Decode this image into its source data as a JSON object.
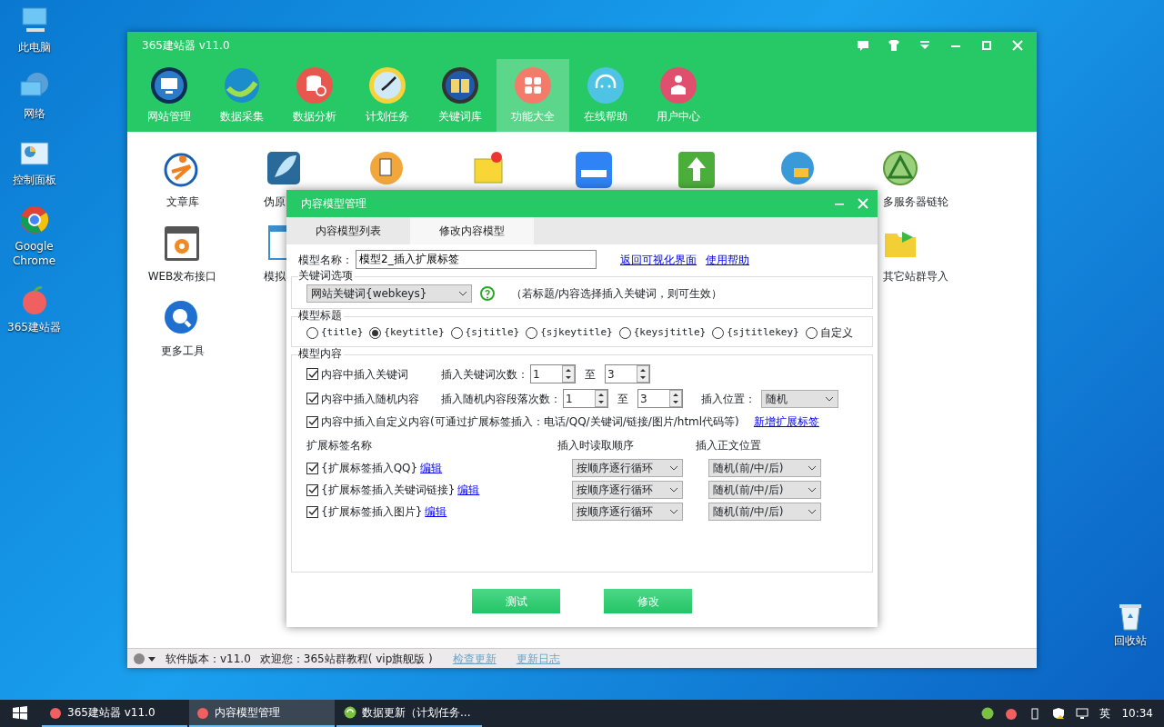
{
  "desktop_icons": [
    {
      "label": "此电脑"
    },
    {
      "label": "网络"
    },
    {
      "label": "控制面板"
    },
    {
      "label": "Google Chrome"
    },
    {
      "label": "365建站器"
    }
  ],
  "recycle_bin": {
    "label": "回收站"
  },
  "app_window": {
    "title": "365建站器 v11.0",
    "toolbar": [
      {
        "label": "网站管理",
        "selected": false
      },
      {
        "label": "数据采集",
        "selected": false
      },
      {
        "label": "数据分析",
        "selected": false
      },
      {
        "label": "计划任务",
        "selected": false
      },
      {
        "label": "关键词库",
        "selected": false
      },
      {
        "label": "功能大全",
        "selected": true
      },
      {
        "label": "在线帮助",
        "selected": false
      },
      {
        "label": "用户中心",
        "selected": false
      }
    ],
    "features": [
      {
        "label": "文章库"
      },
      {
        "label": "伪原"
      },
      {
        "label": "多服务器链轮"
      },
      {
        "label": "WEB发布接口"
      },
      {
        "label": "模拟"
      },
      {
        "label": "其它站群导入"
      },
      {
        "label": "更多工具"
      }
    ],
    "status_bar": {
      "version": "软件版本：v11.0",
      "welcome": "欢迎您：365站群教程( vip旗舰版 )",
      "links": [
        "检查更新",
        "更新日志"
      ]
    }
  },
  "dialog": {
    "title": "内容模型管理",
    "tabs": [
      {
        "label": "内容模型列表",
        "selected": false
      },
      {
        "label": "修改内容模型",
        "selected": true
      }
    ],
    "model_name": {
      "label": "模型名称：",
      "value": "模型2_插入扩展标签"
    },
    "links": [
      "返回可视化界面",
      "使用帮助"
    ],
    "keyword_group": {
      "legend": "关键词选项",
      "select": "网站关键词{webkeys}",
      "hint": "（若标题/内容选择插入关键词，则可生效）"
    },
    "title_group": {
      "legend": "模型标题",
      "options": [
        {
          "label": "{title}",
          "selected": false
        },
        {
          "label": "{keytitle}",
          "selected": true
        },
        {
          "label": "{sjtitle}",
          "selected": false
        },
        {
          "label": "{sjkeytitle}",
          "selected": false
        },
        {
          "label": "{keysjtitle}",
          "selected": false
        },
        {
          "label": "{sjtitlekey}",
          "selected": false
        },
        {
          "label": "自定义",
          "selected": false
        }
      ]
    },
    "content_group": {
      "legend": "模型内容",
      "rows": [
        {
          "label": "内容中插入关键词",
          "checked": true,
          "count_label": "插入关键词次数：",
          "from": "1",
          "to_label": "至",
          "to": "3"
        },
        {
          "label": "内容中插入随机内容",
          "checked": true,
          "count_label": "插入随机内容段落次数：",
          "from": "1",
          "to_label": "至",
          "to": "3",
          "position_label": "插入位置：",
          "position": "随机"
        }
      ],
      "custom": {
        "label": "内容中插入自定义内容(可通过扩展标签插入：电话/QQ/关键词/链接/图片/html代码等)",
        "checked": true,
        "link": "新增扩展标签"
      },
      "tag_columns": [
        "扩展标签名称",
        "插入时读取顺序",
        "插入正文位置"
      ],
      "tags": [
        {
          "name": "{扩展标签插入QQ}",
          "checked": true,
          "edit": "编辑",
          "order": "按顺序逐行循环",
          "position": "随机(前/中/后)"
        },
        {
          "name": "{扩展标签插入关键词链接}",
          "checked": true,
          "edit": "编辑",
          "order": "按顺序逐行循环",
          "position": "随机(前/中/后)"
        },
        {
          "name": "{扩展标签插入图片}",
          "checked": true,
          "edit": "编辑",
          "order": "按顺序逐行循环",
          "position": "随机(前/中/后)"
        }
      ]
    },
    "buttons": [
      "测试",
      "修改"
    ]
  },
  "taskbar": {
    "items": [
      {
        "label": "365建站器 v11.0",
        "selected": false
      },
      {
        "label": "内容模型管理",
        "selected": true
      },
      {
        "label": "数据更新（计划任务...",
        "selected": false
      }
    ],
    "language": "英",
    "time": "10:34"
  }
}
